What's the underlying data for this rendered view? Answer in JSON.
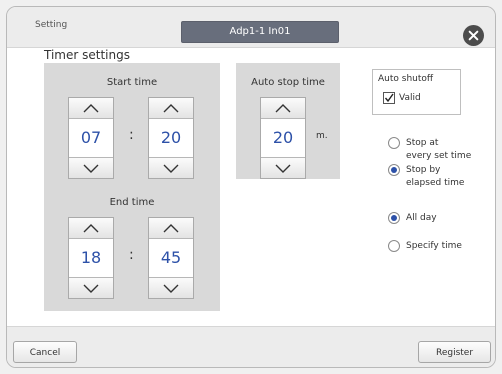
{
  "header": {
    "setting_label": "Setting",
    "device_name": "Adp1-1 In01",
    "close_icon": "close-icon"
  },
  "timer": {
    "section_title": "Timer settings",
    "start_label": "Start time",
    "end_label": "End time",
    "start_hour": "07",
    "start_minute": "20",
    "end_hour": "18",
    "end_minute": "45",
    "separator": ":"
  },
  "auto_stop": {
    "label": "Auto stop time",
    "value": "20",
    "unit": "m."
  },
  "auto_shutoff": {
    "title": "Auto shutoff",
    "valid_label": "Valid",
    "valid_checked": true
  },
  "stop_mode": {
    "options": [
      {
        "label_lines": [
          "Stop at",
          "every set time"
        ],
        "selected": false
      },
      {
        "label_lines": [
          "Stop by",
          "elapsed time"
        ],
        "selected": true
      }
    ]
  },
  "time_range": {
    "options": [
      {
        "label": "All day",
        "selected": true
      },
      {
        "label": "Specify time",
        "selected": false
      }
    ]
  },
  "footer": {
    "cancel_label": "Cancel",
    "register_label": "Register"
  },
  "colors": {
    "accent": "#2d51a8",
    "tab_bg": "#686e7c",
    "panel_bg": "#d9d9d9"
  }
}
